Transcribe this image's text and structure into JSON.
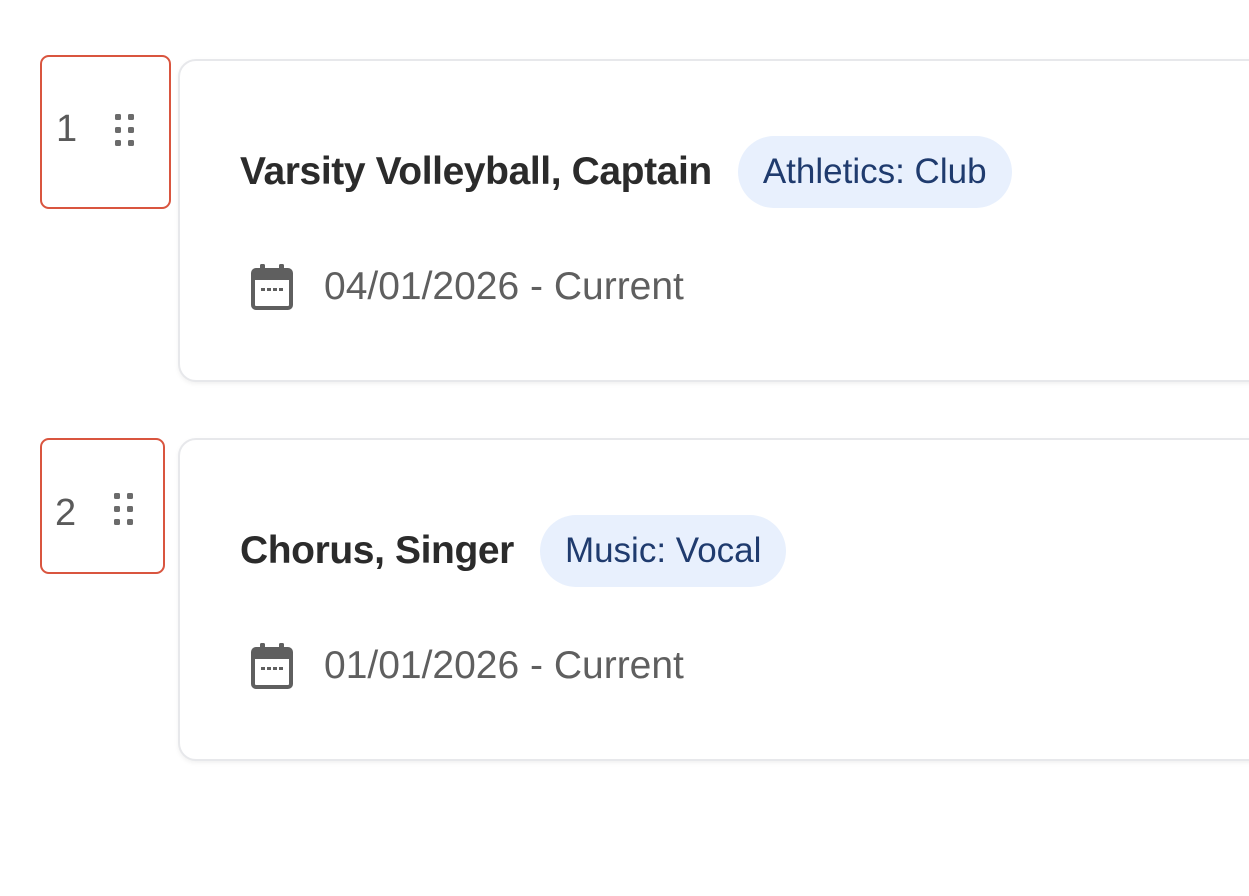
{
  "activities": [
    {
      "rank": "1",
      "title": "Varsity Volleyball, Captain",
      "category": "Athletics: Club",
      "dates": "04/01/2026 - Current"
    },
    {
      "rank": "2",
      "title": "Chorus, Singer",
      "category": "Music: Vocal",
      "dates": "01/01/2026 - Current"
    }
  ],
  "icons": {
    "handle": "drag-grip-icon",
    "date": "calendar-icon"
  },
  "colors": {
    "handle_outline": "#d9553f",
    "tag_background": "#e8f0fd",
    "tag_text": "#1f3b6e",
    "title_text": "#2b2b2b",
    "secondary_text": "#5f5f5f",
    "card_border": "#e7e8eb"
  }
}
